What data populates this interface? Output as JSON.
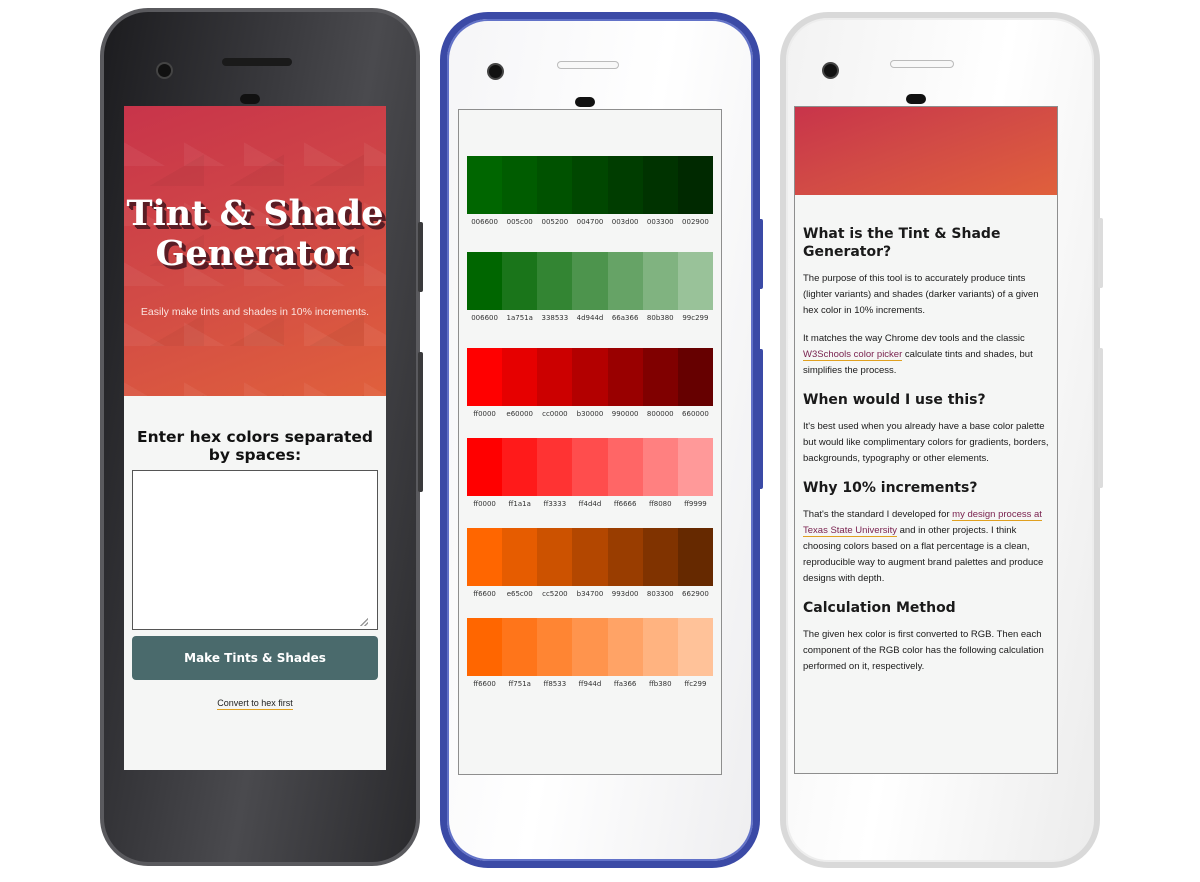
{
  "phone1": {
    "title_line1": "Tint & Shade",
    "title_line2": "Generator",
    "subtitle": "Easily make tints and shades in 10% increments.",
    "input_label": "Enter hex colors separated by spaces:",
    "input_value": "",
    "button_label": "Make Tints & Shades",
    "convert_link": "Convert to hex first"
  },
  "phone2": {
    "palettes": [
      {
        "colors": [
          "#006600",
          "#005c00",
          "#005200",
          "#004700",
          "#003d00",
          "#003300",
          "#002900"
        ],
        "codes": [
          "006600",
          "005c00",
          "005200",
          "004700",
          "003d00",
          "003300",
          "002900"
        ]
      },
      {
        "colors": [
          "#006600",
          "#1a751a",
          "#338533",
          "#4d944d",
          "#66a366",
          "#80b380",
          "#99c299"
        ],
        "codes": [
          "006600",
          "1a751a",
          "338533",
          "4d944d",
          "66a366",
          "80b380",
          "99c299"
        ]
      },
      {
        "colors": [
          "#ff0000",
          "#e60000",
          "#cc0000",
          "#b30000",
          "#990000",
          "#800000",
          "#660000"
        ],
        "codes": [
          "ff0000",
          "e60000",
          "cc0000",
          "b30000",
          "990000",
          "800000",
          "660000"
        ]
      },
      {
        "colors": [
          "#ff0000",
          "#ff1a1a",
          "#ff3333",
          "#ff4d4d",
          "#ff6666",
          "#ff8080",
          "#ff9999"
        ],
        "codes": [
          "ff0000",
          "ff1a1a",
          "ff3333",
          "ff4d4d",
          "ff6666",
          "ff8080",
          "ff9999"
        ]
      },
      {
        "colors": [
          "#ff6600",
          "#e65c00",
          "#cc5200",
          "#b34700",
          "#993d00",
          "#803300",
          "#662900"
        ],
        "codes": [
          "ff6600",
          "e65c00",
          "cc5200",
          "b34700",
          "993d00",
          "803300",
          "662900"
        ]
      },
      {
        "colors": [
          "#ff6600",
          "#ff751a",
          "#ff8533",
          "#ff944d",
          "#ffa366",
          "#ffb380",
          "#ffc299"
        ],
        "codes": [
          "ff6600",
          "ff751a",
          "ff8533",
          "ff944d",
          "ffa366",
          "ffb380",
          "ffc299"
        ]
      }
    ]
  },
  "phone3": {
    "h_what": "What is the Tint & Shade Generator?",
    "p_what_1": "The purpose of this tool is to accurately produce tints (lighter variants) and shades (darker variants) of a given hex color in 10% increments.",
    "p_what_2_a": "It matches the way Chrome dev tools and the classic ",
    "p_what_2_link": "W3Schools color picker",
    "p_what_2_b": " calculate tints and shades, but simplifies the process.",
    "h_when": "When would I use this?",
    "p_when": "It's best used when you already have a base color palette but would like complimentary colors for gradients, borders, backgrounds, typography or other elements.",
    "h_why": "Why 10% increments?",
    "p_why_a": "That's the standard I developed for ",
    "p_why_link": "my design process at Texas State University",
    "p_why_b": " and in other projects. I think choosing colors based on a flat percentage is a clean, reproducible way to augment brand palettes and produce designs with depth.",
    "h_calc": "Calculation Method",
    "p_calc": "The given hex color is first converted to RGB. Then each component of the RGB color has the following calculation performed on it, respectively."
  }
}
